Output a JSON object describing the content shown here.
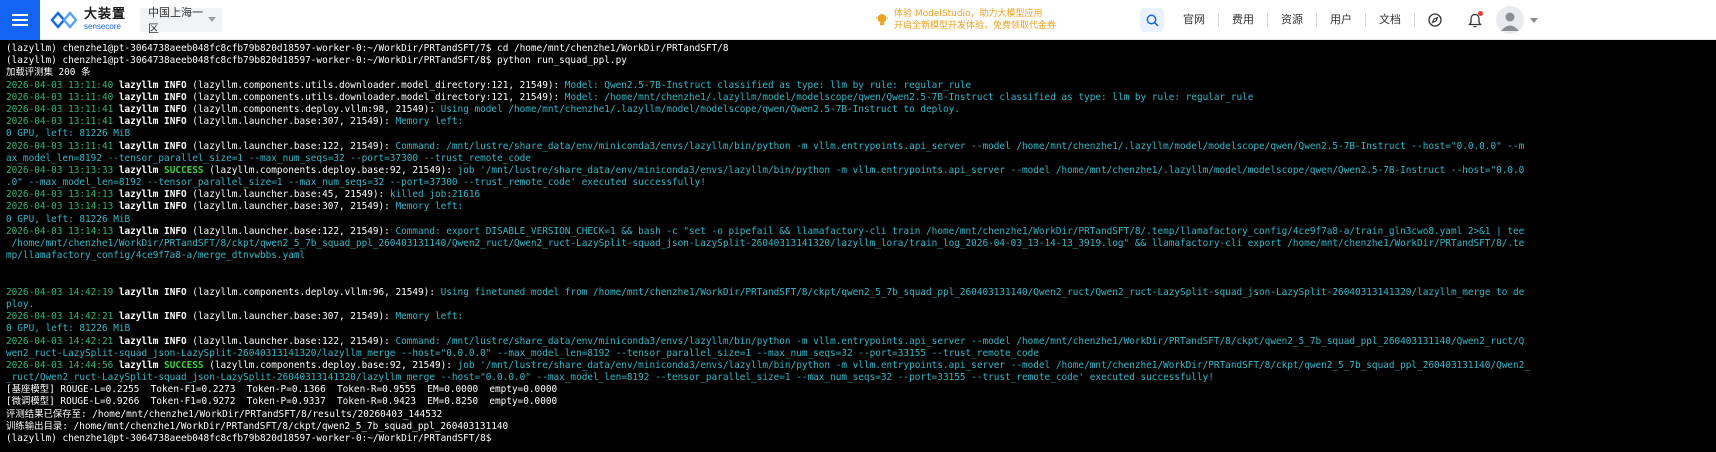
{
  "header": {
    "logo_cn": "大装置",
    "logo_en": "sensecore",
    "region": "中国上海一区",
    "promo_line1": "体验 ModelStudio，助力大模型应用",
    "promo_line2": "开启全新模型开发体验，免费领取代金券",
    "nav": [
      "官网",
      "费用",
      "资源",
      "用户",
      "文档"
    ],
    "colors": {
      "menu_bg": "#1464f6",
      "accent": "#1464f6",
      "promo": "#f0a020"
    }
  },
  "terminal": {
    "colors": {
      "timestamp": "#2bb673",
      "message": "#2fb9c9",
      "success": "#3cd23c",
      "text": "#ffffff",
      "background": "#000000"
    },
    "lines": [
      [
        [
          "plain",
          "(lazyllm) chenzhe1@pt-3064738aeeb048fc8cfb79b820d18597-worker-0:~/WorkDir/PRTandSFT/7$ cd /home/mnt/chenzhe1/WorkDir/PRTandSFT/8"
        ]
      ],
      [
        [
          "plain",
          "(lazyllm) chenzhe1@pt-3064738aeeb048fc8cfb79b820d18597-worker-0:~/WorkDir/PRTandSFT/8$ python run_squad_ppl.py"
        ]
      ],
      [
        [
          "plain",
          "加载评测集 200 条"
        ]
      ],
      [
        [
          "ts",
          "2026-04-03 13:11:40 "
        ],
        [
          "lvl",
          "lazyllm INFO"
        ],
        [
          "src",
          " (lazyllm.components.utils.downloader.model_directory:121, 21549): "
        ],
        [
          "msg",
          "Model: Qwen2.5-7B-Instruct classified as type: llm by rule: regular_rule"
        ]
      ],
      [
        [
          "ts",
          "2026-04-03 13:11:40 "
        ],
        [
          "lvl",
          "lazyllm INFO"
        ],
        [
          "src",
          " (lazyllm.components.utils.downloader.model_directory:121, 21549): "
        ],
        [
          "msg",
          "Model: /home/mnt/chenzhe1/.lazyllm/model/modelscope/qwen/Qwen2.5-7B-Instruct classified as type: llm by rule: regular_rule"
        ]
      ],
      [
        [
          "ts",
          "2026-04-03 13:11:41 "
        ],
        [
          "lvl",
          "lazyllm INFO"
        ],
        [
          "src",
          " (lazyllm.components.deploy.vllm:98, 21549): "
        ],
        [
          "msg",
          "Using model /home/mnt/chenzhe1/.lazyllm/model/modelscope/qwen/Qwen2.5-7B-Instruct to deploy."
        ]
      ],
      [
        [
          "ts",
          "2026-04-03 13:11:41 "
        ],
        [
          "lvl",
          "lazyllm INFO"
        ],
        [
          "src",
          " (lazyllm.launcher.base:307, 21549): "
        ],
        [
          "msg",
          "Memory left:"
        ]
      ],
      [
        [
          "msg",
          "0 GPU, left: 81226 MiB"
        ]
      ],
      [
        [
          "ts",
          "2026-04-03 13:11:41 "
        ],
        [
          "lvl",
          "lazyllm INFO"
        ],
        [
          "src",
          " (lazyllm.launcher.base:122, 21549): "
        ],
        [
          "msg",
          "Command: /mnt/lustre/share_data/env/miniconda3/envs/lazyllm/bin/python -m vllm.entrypoints.api_server --model /home/mnt/chenzhe1/.lazyllm/model/modelscope/qwen/Qwen2.5-7B-Instruct --host=\"0.0.0.0\" --m"
        ]
      ],
      [
        [
          "msg",
          "ax_model_len=8192 --tensor_parallel_size=1 --max_num_seqs=32 --port=37300 --trust_remote_code"
        ]
      ],
      [
        [
          "ts",
          "2026-04-03 13:13:33 "
        ],
        [
          "lvl",
          "lazyllm "
        ],
        [
          "ok",
          "SUCCESS"
        ],
        [
          "src",
          " (lazyllm.components.deploy.base:92, 21549): "
        ],
        [
          "msg",
          "job '/mnt/lustre/share_data/env/miniconda3/envs/lazyllm/bin/python -m vllm.entrypoints.api_server --model /home/mnt/chenzhe1/.lazyllm/model/modelscope/qwen/Qwen2.5-7B-Instruct --host=\"0.0.0"
        ]
      ],
      [
        [
          "msg",
          ".0\" --max_model_len=8192 --tensor_parallel_size=1 --max_num_seqs=32 --port=37300 --trust_remote_code' executed successfully!"
        ]
      ],
      [
        [
          "ts",
          "2026-04-03 13:14:13 "
        ],
        [
          "lvl",
          "lazyllm INFO"
        ],
        [
          "src",
          " (lazyllm.launcher.base:45, 21549): "
        ],
        [
          "msg",
          "killed job:21616"
        ]
      ],
      [
        [
          "ts",
          "2026-04-03 13:14:13 "
        ],
        [
          "lvl",
          "lazyllm INFO"
        ],
        [
          "src",
          " (lazyllm.launcher.base:307, 21549): "
        ],
        [
          "msg",
          "Memory left:"
        ]
      ],
      [
        [
          "msg",
          "0 GPU, left: 81226 MiB"
        ]
      ],
      [
        [
          "ts",
          "2026-04-03 13:14:13 "
        ],
        [
          "lvl",
          "lazyllm INFO"
        ],
        [
          "src",
          " (lazyllm.launcher.base:122, 21549): "
        ],
        [
          "msg",
          "Command: export DISABLE_VERSION_CHECK=1 && bash -c \"set -o pipefail && llamafactory-cli train /home/mnt/chenzhe1/WorkDir/PRTandSFT/8/.temp/llamafactory_config/4ce9f7a8-a/train_gln3cwo8.yaml 2>&1 | tee"
        ]
      ],
      [
        [
          "msg",
          " /home/mnt/chenzhe1/WorkDir/PRTandSFT/8/ckpt/qwen2_5_7b_squad_ppl_260403131140/Qwen2_ruct/Qwen2_ruct-LazySplit-squad_json-LazySplit-26040313141320/lazyllm_lora/train_log_2026-04-03_13-14-13_3919.log\" && llamafactory-cli export /home/mnt/chenzhe1/WorkDir/PRTandSFT/8/.te"
        ]
      ],
      [
        [
          "msg",
          "mp/llamafactory_config/4ce9f7a8-a/merge_dtnvwbbs.yaml"
        ]
      ],
      [],
      [],
      [
        [
          "ts",
          "2026-04-03 14:42:19 "
        ],
        [
          "lvl",
          "lazyllm INFO"
        ],
        [
          "src",
          " (lazyllm.components.deploy.vllm:96, 21549): "
        ],
        [
          "msg",
          "Using finetuned model from /home/mnt/chenzhe1/WorkDir/PRTandSFT/8/ckpt/qwen2_5_7b_squad_ppl_260403131140/Qwen2_ruct/Qwen2_ruct-LazySplit-squad_json-LazySplit-26040313141320/lazyllm_merge to de"
        ]
      ],
      [
        [
          "msg",
          "ploy."
        ]
      ],
      [
        [
          "ts",
          "2026-04-03 14:42:21 "
        ],
        [
          "lvl",
          "lazyllm INFO"
        ],
        [
          "src",
          " (lazyllm.launcher.base:307, 21549): "
        ],
        [
          "msg",
          "Memory left:"
        ]
      ],
      [
        [
          "msg",
          "0 GPU, left: 81226 MiB"
        ]
      ],
      [
        [
          "ts",
          "2026-04-03 14:42:21 "
        ],
        [
          "lvl",
          "lazyllm INFO"
        ],
        [
          "src",
          " (lazyllm.launcher.base:122, 21549): "
        ],
        [
          "msg",
          "Command: /mnt/lustre/share_data/env/miniconda3/envs/lazyllm/bin/python -m vllm.entrypoints.api_server --model /home/mnt/chenzhe1/WorkDir/PRTandSFT/8/ckpt/qwen2_5_7b_squad_ppl_260403131140/Qwen2_ruct/Q"
        ]
      ],
      [
        [
          "msg",
          "wen2_ruct-LazySplit-squad_json-LazySplit-26040313141320/lazyllm_merge --host=\"0.0.0.0\" --max_model_len=8192 --tensor_parallel_size=1 --max_num_seqs=32 --port=33155 --trust_remote_code"
        ]
      ],
      [
        [
          "ts",
          "2026-04-03 14:44:56 "
        ],
        [
          "lvl",
          "lazyllm "
        ],
        [
          "ok",
          "SUCCESS"
        ],
        [
          "src",
          " (lazyllm.components.deploy.base:92, 21549): "
        ],
        [
          "msg",
          "job '/mnt/lustre/share_data/env/miniconda3/envs/lazyllm/bin/python -m vllm.entrypoints.api_server --model /home/mnt/chenzhe1/WorkDir/PRTandSFT/8/ckpt/qwen2_5_7b_squad_ppl_260403131140/Qwen2_"
        ]
      ],
      [
        [
          "msg",
          "_ruct/Qwen2_ruct-LazySplit-squad_json-LazySplit-26040313141320/lazyllm_merge --host=\"0.0.0.0\" --max_model_len=8192 --tensor_parallel_size=1 --max_num_seqs=32 --port=33155 --trust_remote_code' executed successfully!"
        ]
      ],
      [
        [
          "plain",
          "[基座模型] ROUGE-L=0.2255  Token-F1=0.2273  Token-P=0.1366  Token-R=0.9555  EM=0.0000  empty=0.0000"
        ]
      ],
      [
        [
          "plain",
          "[微调模型] ROUGE-L=0.9266  Token-F1=0.9272  Token-P=0.9337  Token-R=0.9423  EM=0.8250  empty=0.0000"
        ]
      ],
      [
        [
          "plain",
          "评测结果已保存至: /home/mnt/chenzhe1/WorkDir/PRTandSFT/8/results/20260403_144532"
        ]
      ],
      [
        [
          "plain",
          "训练输出目录: /home/mnt/chenzhe1/WorkDir/PRTandSFT/8/ckpt/qwen2_5_7b_squad_ppl_260403131140"
        ]
      ],
      [
        [
          "plain",
          "(lazyllm) chenzhe1@pt-3064738aeeb048fc8cfb79b820d18597-worker-0:~/WorkDir/PRTandSFT/8$ "
        ]
      ]
    ]
  }
}
